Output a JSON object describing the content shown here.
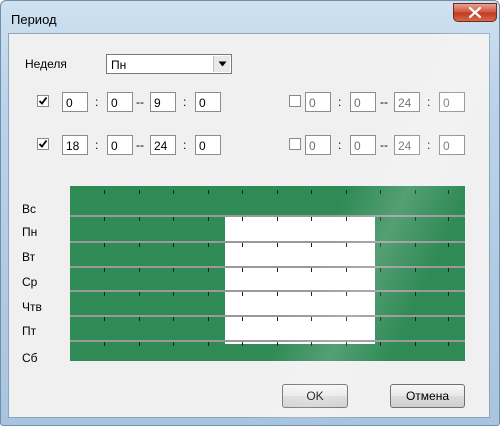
{
  "window": {
    "title": "Период"
  },
  "week": {
    "label": "Неделя",
    "selected": "Пн"
  },
  "time_ranges": [
    {
      "checked": true,
      "start_h": "0",
      "start_m": "0",
      "end_h": "9",
      "end_m": "0"
    },
    {
      "checked": false,
      "start_h": "0",
      "start_m": "0",
      "end_h": "24",
      "end_m": "0"
    },
    {
      "checked": true,
      "start_h": "18",
      "start_m": "0",
      "end_h": "24",
      "end_m": "0"
    },
    {
      "checked": false,
      "start_h": "0",
      "start_m": "0",
      "end_h": "24",
      "end_m": "0"
    }
  ],
  "separators": {
    "colon": ":",
    "dash": "--"
  },
  "schedule": {
    "days": [
      "Вс",
      "Пн",
      "Вт",
      "Ср",
      "Чтв",
      "Пт",
      "Сб"
    ],
    "active_color": "#2f8a55",
    "inactive_color": "#ffffff"
  },
  "buttons": {
    "ok": "OK",
    "cancel": "Отмена"
  }
}
